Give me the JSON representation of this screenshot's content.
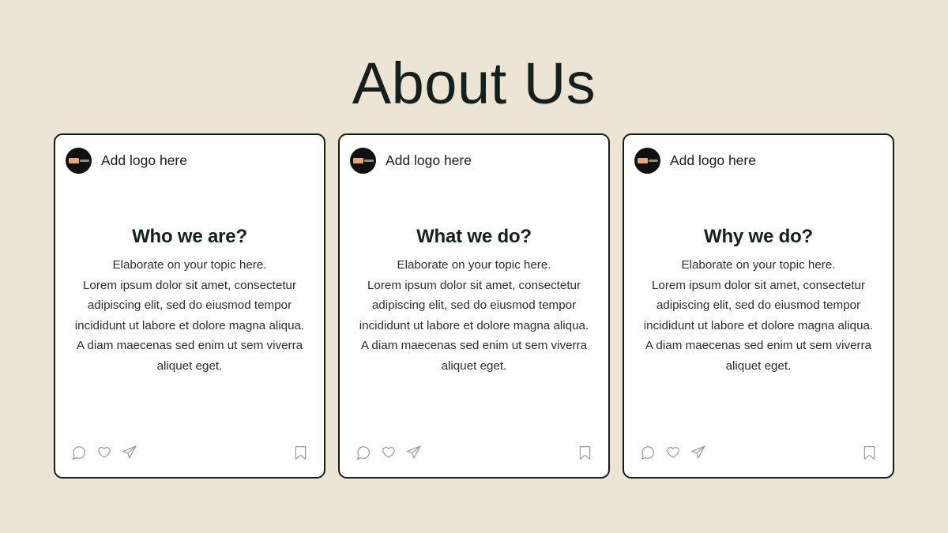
{
  "slide": {
    "title": "About Us",
    "background_color": "#ece5d6",
    "title_color": "#15201c",
    "card_border_color": "#15201c",
    "card_background_color": "#ffffff",
    "accent_color": "#e8a47c"
  },
  "cards": [
    {
      "logo_label": "Add logo here",
      "heading": "Who we are?",
      "lead": "Elaborate on your topic here.",
      "body": "Lorem ipsum dolor sit amet, consectetur adipiscing elit, sed do eiusmod tempor incididunt ut labore et dolore magna aliqua. A diam maecenas sed enim ut sem viverra aliquet eget."
    },
    {
      "logo_label": "Add logo here",
      "heading": "What we do?",
      "lead": "Elaborate on your topic here.",
      "body": "Lorem ipsum dolor sit amet, consectetur adipiscing elit, sed do eiusmod tempor incididunt ut labore et dolore magna aliqua. A diam maecenas sed enim ut sem viverra aliquet eget."
    },
    {
      "logo_label": "Add logo here",
      "heading": "Why we do?",
      "lead": "Elaborate on your topic here.",
      "body": "Lorem ipsum dolor sit amet, consectetur adipiscing elit, sed do eiusmod tempor incididunt ut labore et dolore magna aliqua. A diam maecenas sed enim ut sem viverra aliquet eget."
    }
  ],
  "footer_icons": [
    "comment-icon",
    "heart-icon",
    "send-icon",
    "bookmark-icon"
  ]
}
